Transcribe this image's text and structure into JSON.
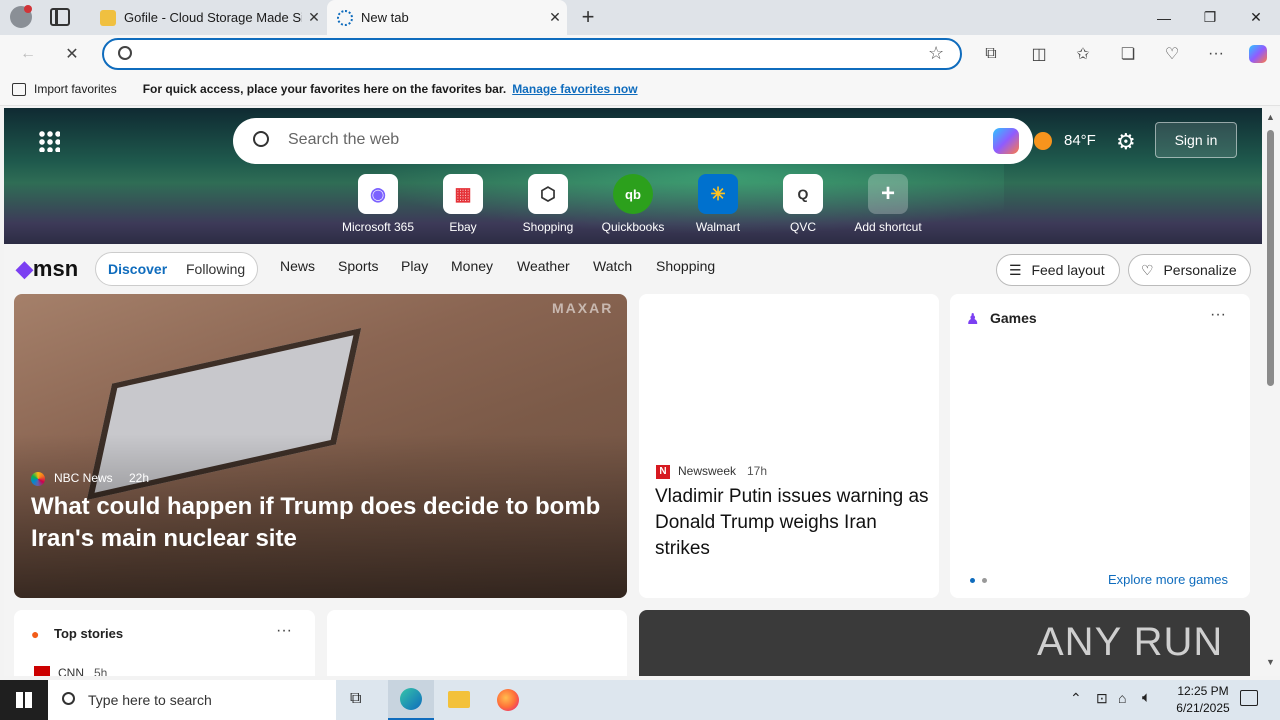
{
  "browser": {
    "tabs": [
      {
        "title": "Gofile - Cloud Storage Made Simp",
        "active": false
      },
      {
        "title": "New tab",
        "active": true
      }
    ],
    "address_placeholder": "",
    "favorites_bar": {
      "import_label": "Import favorites",
      "message": "For quick access, place your favorites here on the favorites bar.",
      "manage_link": "Manage favorites now"
    }
  },
  "msn": {
    "search_placeholder": "Search the web",
    "weather": "84°F",
    "weather_unit": "°F",
    "weather_temp": "84",
    "sign_in": "Sign in",
    "shortcuts": [
      {
        "label": "Microsoft 365",
        "icon": "microsoft-365-icon"
      },
      {
        "label": "Ebay",
        "icon": "ebay-icon"
      },
      {
        "label": "Shopping",
        "icon": "shopping-tag-icon"
      },
      {
        "label": "Quickbooks",
        "icon": "quickbooks-icon"
      },
      {
        "label": "Walmart",
        "icon": "walmart-icon"
      },
      {
        "label": "QVC",
        "icon": "qvc-icon"
      },
      {
        "label": "Add shortcut",
        "icon": "plus-icon"
      }
    ],
    "logo": "msn",
    "nav_pills": [
      "Discover",
      "Following"
    ],
    "nav_links": [
      "News",
      "Sports",
      "Play",
      "Money",
      "Weather",
      "Watch",
      "Shopping"
    ],
    "feed_layout": "Feed layout",
    "personalize": "Personalize",
    "hero_story": {
      "source": "NBC News",
      "age": "22h",
      "headline": "What could happen if Trump does decide to bomb Iran's main nuclear site",
      "watermark": "MAXAR"
    },
    "side_story": {
      "source": "Newsweek",
      "age": "17h",
      "headline": "Vladimir Putin issues warning as Donald Trump weighs Iran strikes"
    },
    "games": {
      "title": "Games",
      "explore": "Explore more games"
    },
    "top_stories": {
      "title": "Top stories",
      "first_source": "CNN",
      "first_age": "5h"
    },
    "bottom_watermark": "ANY RUN"
  },
  "taskbar": {
    "search_placeholder": "Type here to search",
    "time": "12:25 PM",
    "date": "6/21/2025"
  },
  "colors": {
    "accent": "#0f6cbd",
    "msn_discover": "#0f6cbd"
  }
}
